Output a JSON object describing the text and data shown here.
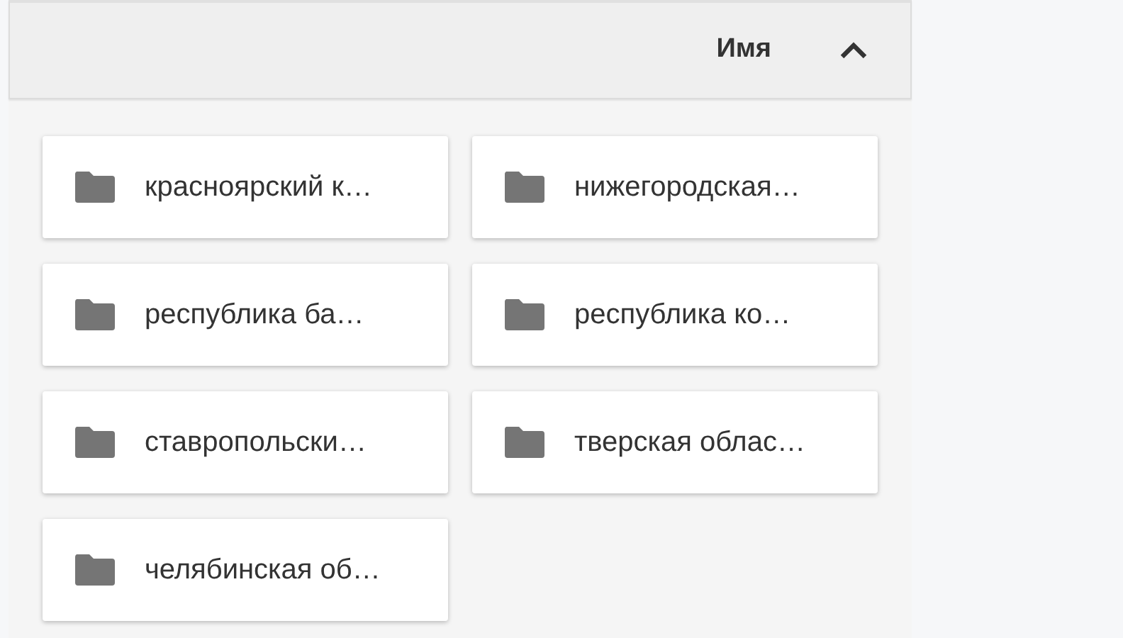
{
  "header": {
    "sort_label": "Имя"
  },
  "folders": [
    {
      "name": "красноярский к…"
    },
    {
      "name": "нижегородская…"
    },
    {
      "name": "республика ба…"
    },
    {
      "name": "республика ко…"
    },
    {
      "name": "ставропольски…"
    },
    {
      "name": "тверская облас…"
    },
    {
      "name": "челябинская об…"
    }
  ]
}
